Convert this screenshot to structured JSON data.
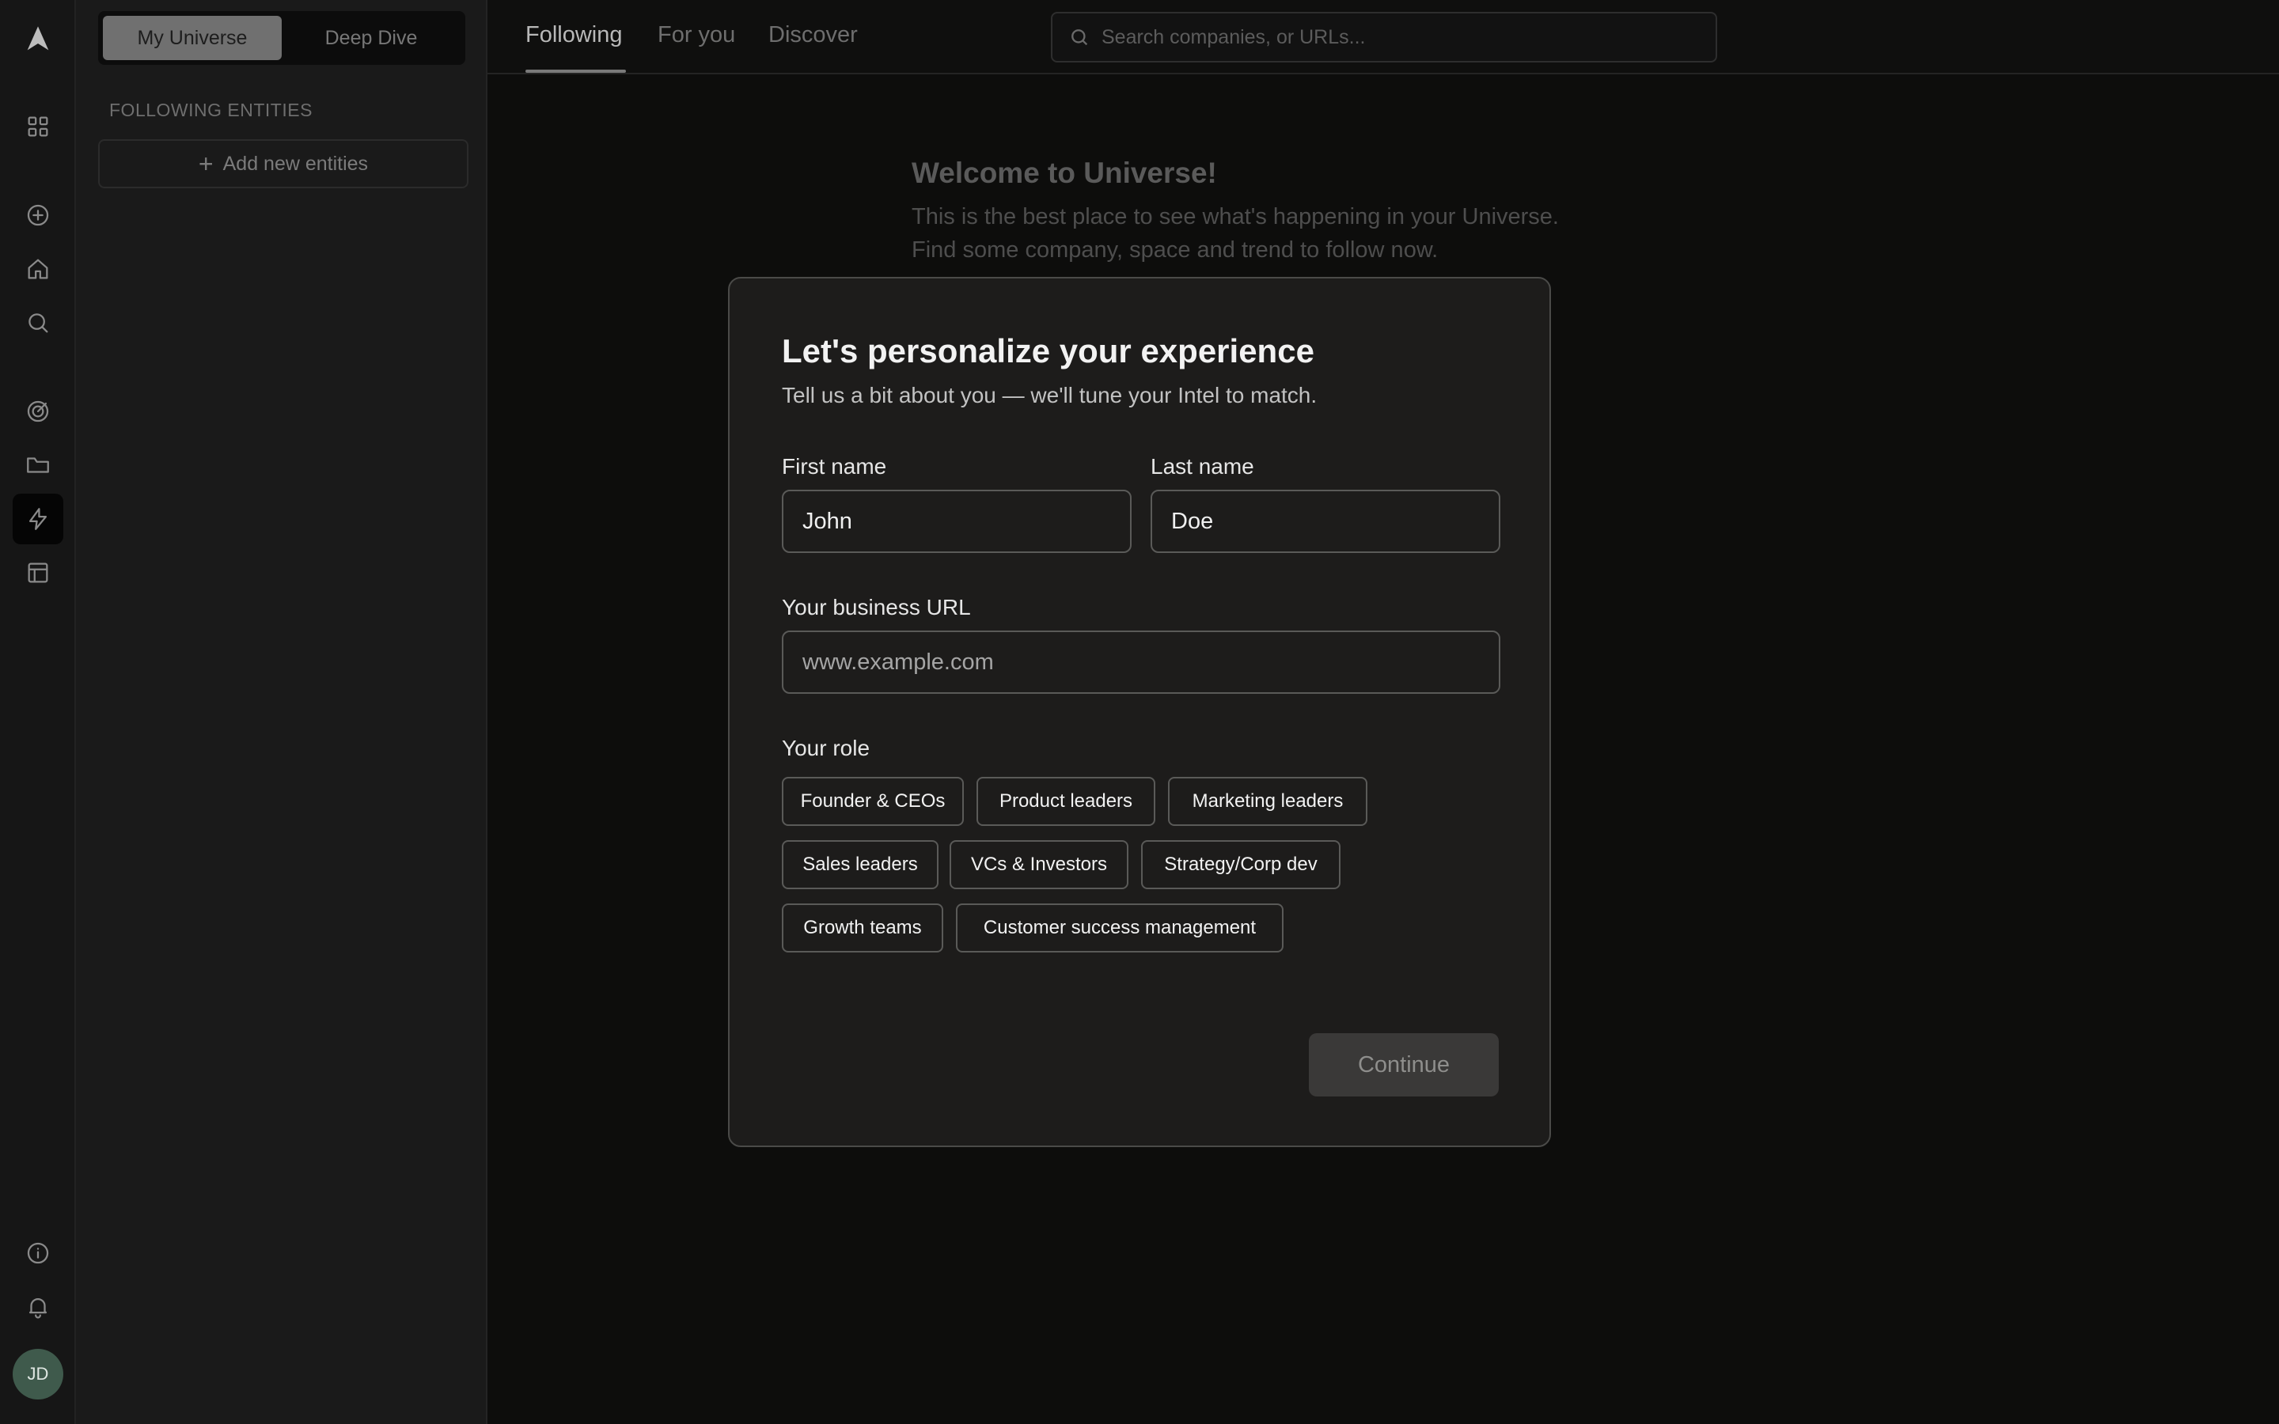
{
  "rail": {
    "avatar_initials": "JD"
  },
  "sidebar": {
    "segments": [
      "My Universe",
      "Deep Dive"
    ],
    "section_title": "FOLLOWING ENTITIES",
    "add_label": "Add new entities"
  },
  "topbar": {
    "tabs": [
      "Following",
      "For you",
      "Discover"
    ],
    "search_placeholder": "Search companies, or URLs..."
  },
  "welcome": {
    "title": "Welcome to Universe!",
    "line1": "This is the best place to see what's happening in your Universe.",
    "line2": "Find some company, space and trend to follow now."
  },
  "modal": {
    "title": "Let's personalize your experience",
    "subtitle": "Tell us a bit about you — we'll tune your Intel to match.",
    "first_name_label": "First name",
    "first_name_value": "John",
    "last_name_label": "Last name",
    "last_name_value": "Doe",
    "url_label": "Your business URL",
    "url_placeholder": "www.example.com",
    "role_label": "Your role",
    "roles": [
      "Founder & CEOs",
      "Product leaders",
      "Marketing leaders",
      "Sales leaders",
      "VCs & Investors",
      "Strategy/Corp dev",
      "Growth teams",
      "Customer success management"
    ],
    "continue_label": "Continue"
  }
}
